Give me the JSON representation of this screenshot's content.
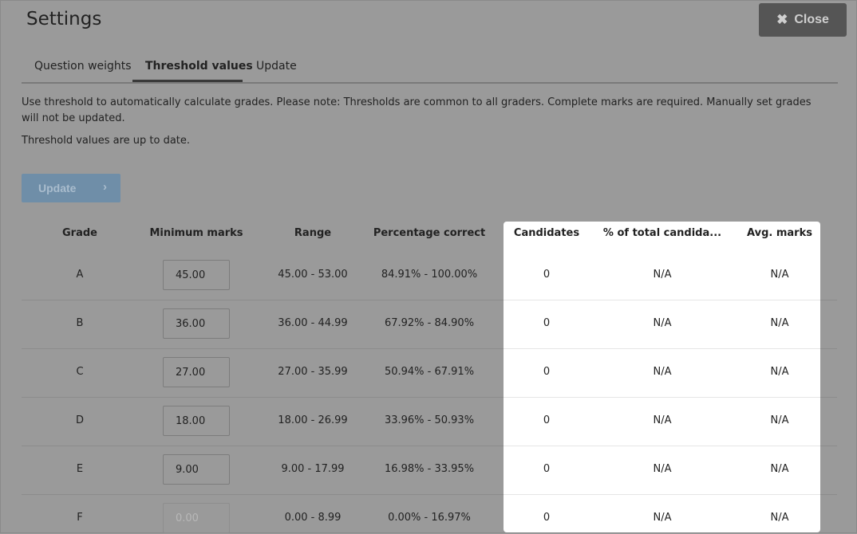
{
  "dialog": {
    "title": "Settings",
    "close_label": "Close"
  },
  "tabs": [
    {
      "label": "Question weights",
      "active": false
    },
    {
      "label": "Threshold values",
      "active": true
    },
    {
      "label": "Update",
      "active": false
    }
  ],
  "note": "Use threshold to automatically calculate grades. Please note: Thresholds are common to all graders. Complete marks are required. Manually set grades will not be updated.",
  "status": "Threshold values are up to date.",
  "update_button": {
    "label": "Update",
    "enabled": false
  },
  "table": {
    "headers": [
      "Grade",
      "Minimum marks",
      "Range",
      "Percentage correct",
      "Candidates",
      "% of total candida...",
      "Avg. marks"
    ],
    "rows": [
      {
        "grade": "A",
        "min": "45.00",
        "range": "45.00 - 53.00",
        "pct": "84.91% - 100.00%",
        "candidates": "0",
        "pct_total": "N/A",
        "avg": "N/A",
        "editable": true
      },
      {
        "grade": "B",
        "min": "36.00",
        "range": "36.00 - 44.99",
        "pct": "67.92% - 84.90%",
        "candidates": "0",
        "pct_total": "N/A",
        "avg": "N/A",
        "editable": true
      },
      {
        "grade": "C",
        "min": "27.00",
        "range": "27.00 - 35.99",
        "pct": "50.94% - 67.91%",
        "candidates": "0",
        "pct_total": "N/A",
        "avg": "N/A",
        "editable": true
      },
      {
        "grade": "D",
        "min": "18.00",
        "range": "18.00 - 26.99",
        "pct": "33.96% - 50.93%",
        "candidates": "0",
        "pct_total": "N/A",
        "avg": "N/A",
        "editable": true
      },
      {
        "grade": "E",
        "min": "9.00",
        "range": "9.00 - 17.99",
        "pct": "16.98% - 33.95%",
        "candidates": "0",
        "pct_total": "N/A",
        "avg": "N/A",
        "editable": true
      },
      {
        "grade": "F",
        "min": "0.00",
        "range": "0.00 - 8.99",
        "pct": "0.00% - 16.97%",
        "candidates": "0",
        "pct_total": "N/A",
        "avg": "N/A",
        "editable": false
      }
    ]
  }
}
